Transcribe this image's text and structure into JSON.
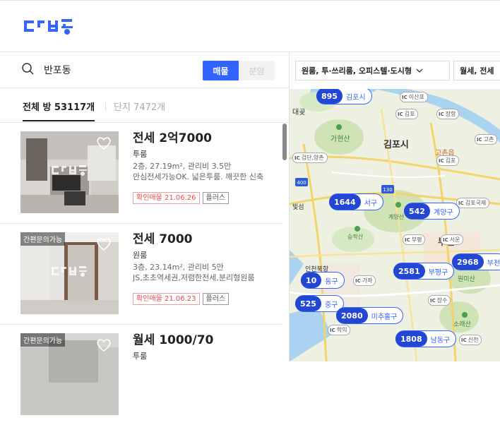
{
  "header": {
    "logo_text": "다방"
  },
  "search": {
    "query": "반포동",
    "segment_on": "매물",
    "segment_off": "분양"
  },
  "tabs": {
    "rooms": "전체 방 53117개",
    "complexes": "단지 7472개"
  },
  "listings": [
    {
      "price": "전세 2억7000",
      "type": "투룸",
      "detail": "2층, 27.19m², 관리비 3.5만",
      "desc": "안심전세가능OK. 넓은투룸. 깨끗한 신축",
      "verified": "확인매물 21.06.26",
      "plus": "플러스",
      "badge": ""
    },
    {
      "price": "전세 7000",
      "type": "원룸",
      "detail": "3층, 23.14m², 관리비 5만",
      "desc": "JS,초초역세권,저렴한전세,분리형원룸",
      "verified": "확인매물 21.06.23",
      "plus": "플러스",
      "badge": "간편문의가능"
    },
    {
      "price": "월세 1000/70",
      "type": "투룸",
      "detail": "",
      "desc": "",
      "verified": "",
      "plus": "",
      "badge": "간편문의가능"
    }
  ],
  "filters": {
    "room_type": "원룸, 투·쓰리룸, 오피스텔·도시형",
    "deal_type": "월세, 전세"
  },
  "map": {
    "clusters": [
      {
        "count": "895",
        "name": "김포시"
      },
      {
        "count": "1644",
        "name": "서구"
      },
      {
        "count": "542",
        "name": "계양구"
      },
      {
        "count": "2968",
        "name": "부천"
      },
      {
        "count": "2581",
        "name": "부평구"
      },
      {
        "count": "10",
        "name": "동구"
      },
      {
        "count": "525",
        "name": "중구"
      },
      {
        "count": "2080",
        "name": "미추홀구"
      },
      {
        "count": "1808",
        "name": "남동구"
      }
    ],
    "labels": {
      "gimpo_city": "김포시",
      "daegot": "대곶",
      "gaeyeongsan": "가현산",
      "gochon": "고촌읍",
      "gyeyang": "계양산",
      "sinhaksan": "승학산",
      "incheon_port": "인천북항",
      "wonmisan": "원미산",
      "sorae": "소래산",
      "bucheon_center": "부천",
      "west_label": "빛섬"
    },
    "ic_labels": [
      "이산포",
      "김포",
      "장항",
      "검단,양촌",
      "김포",
      "고촌",
      "서운",
      "부평",
      "가좌",
      "장수",
      "학익",
      "신천",
      "김포국제"
    ],
    "road_numbers": [
      "400",
      "130"
    ]
  },
  "colors": {
    "accent": "#3264ff",
    "cluster": "#2347d3"
  }
}
